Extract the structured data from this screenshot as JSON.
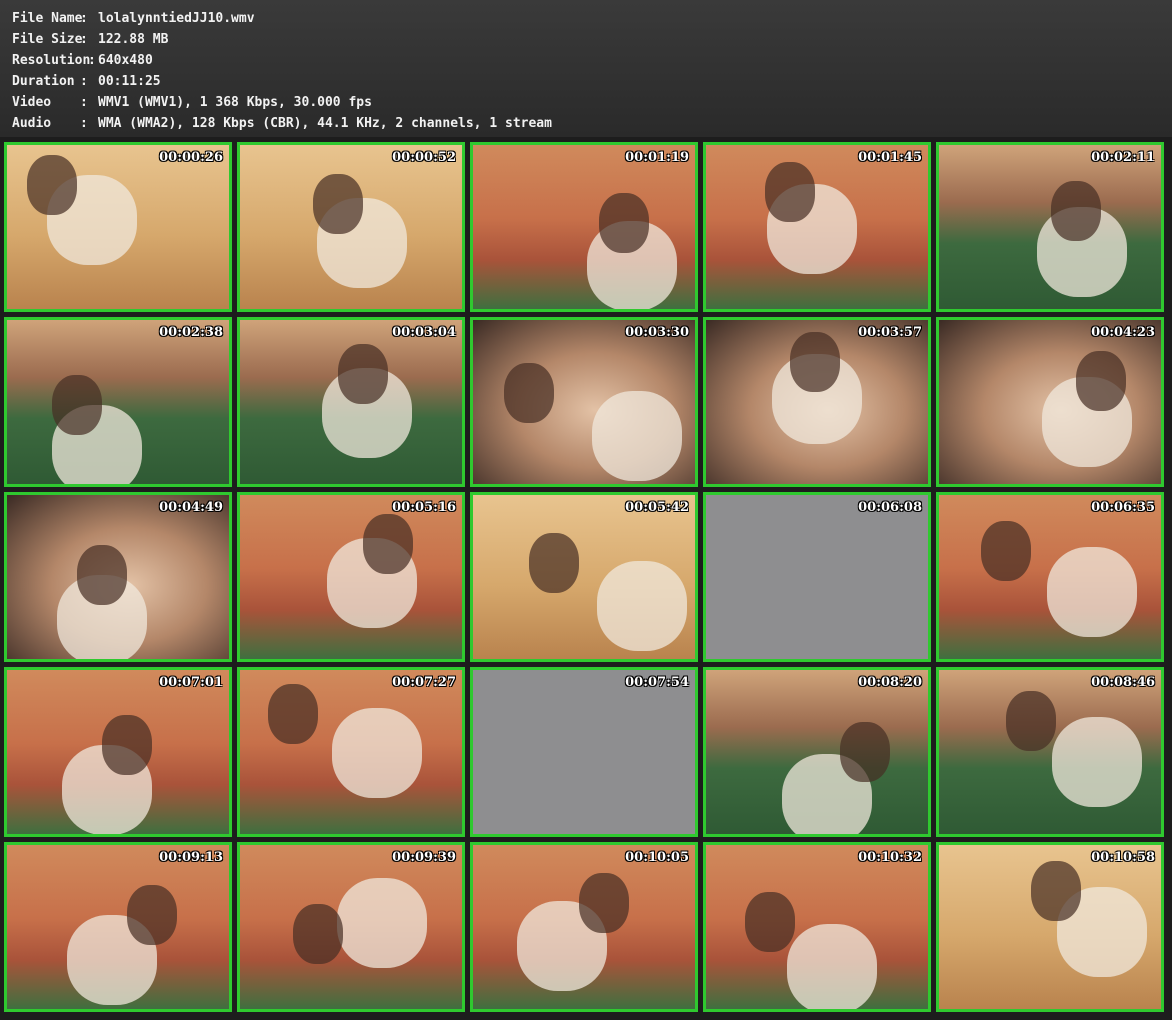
{
  "info": [
    {
      "label": "File Name",
      "sep": ":",
      "value": "lolalynntiedJJ10.wmv"
    },
    {
      "label": "File Size",
      "sep": ":",
      "value": "122.88 MB"
    },
    {
      "label": "Resolution",
      "sep": ":",
      "value": "640x480"
    },
    {
      "label": "Duration",
      "sep": ":",
      "value": "00:11:25"
    },
    {
      "label": "Video",
      "sep": ":",
      "value": "WMV1 (WMV1), 1 368 Kbps, 30.000 fps"
    },
    {
      "label": "Audio",
      "sep": ":",
      "value": "WMA (WMA2), 128 Kbps (CBR), 44.1 KHz, 2 channels, 1 stream"
    }
  ],
  "colors": {
    "border": "#2fc92f",
    "header_bg": "#333333",
    "grid_bg": "#1d1d1d"
  },
  "thumbnails": [
    {
      "time": "00:00:26",
      "scene": "wall"
    },
    {
      "time": "00:00:52",
      "scene": "wall"
    },
    {
      "time": "00:01:19",
      "scene": "sofa"
    },
    {
      "time": "00:01:45",
      "scene": "sofa"
    },
    {
      "time": "00:02:11",
      "scene": "floor"
    },
    {
      "time": "00:02:38",
      "scene": "floor"
    },
    {
      "time": "00:03:04",
      "scene": "floor"
    },
    {
      "time": "00:03:30",
      "scene": "close"
    },
    {
      "time": "00:03:57",
      "scene": "close"
    },
    {
      "time": "00:04:23",
      "scene": "close"
    },
    {
      "time": "00:04:49",
      "scene": "close"
    },
    {
      "time": "00:05:16",
      "scene": "sofa"
    },
    {
      "time": "00:05:42",
      "scene": "wall"
    },
    {
      "time": "00:06:08",
      "scene": "grey"
    },
    {
      "time": "00:06:35",
      "scene": "sofa"
    },
    {
      "time": "00:07:01",
      "scene": "sofa"
    },
    {
      "time": "00:07:27",
      "scene": "sofa"
    },
    {
      "time": "00:07:54",
      "scene": "grey"
    },
    {
      "time": "00:08:20",
      "scene": "floor"
    },
    {
      "time": "00:08:46",
      "scene": "floor"
    },
    {
      "time": "00:09:13",
      "scene": "sofa"
    },
    {
      "time": "00:09:39",
      "scene": "sofa"
    },
    {
      "time": "00:10:05",
      "scene": "sofa"
    },
    {
      "time": "00:10:32",
      "scene": "sofa"
    },
    {
      "time": "00:10:58",
      "scene": "wall"
    }
  ]
}
